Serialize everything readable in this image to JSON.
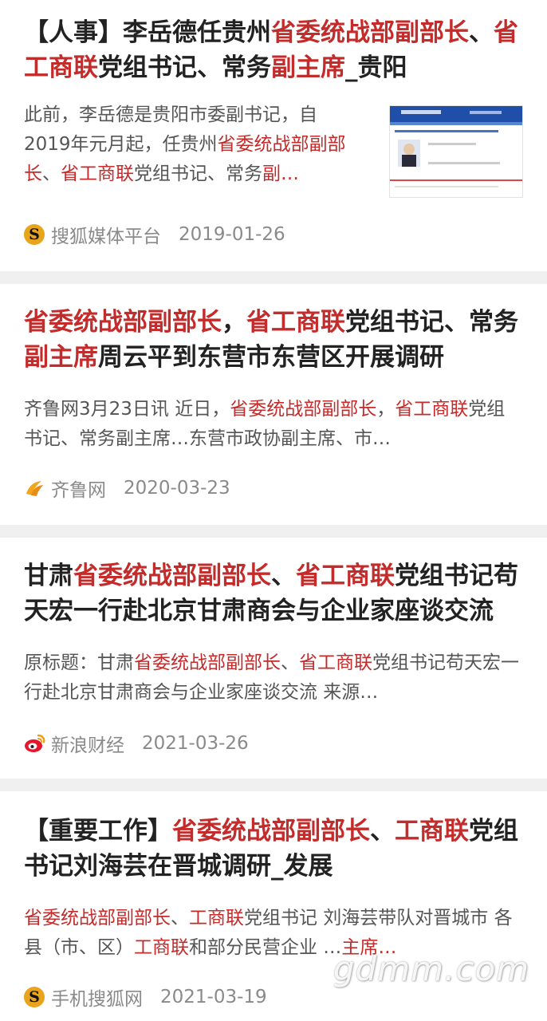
{
  "colors": {
    "highlight": "#c42b2b",
    "text": "#222222",
    "summary": "#555555",
    "meta": "#8a8a8a",
    "separator": "#f0f0f0"
  },
  "articles": [
    {
      "title": [
        {
          "t": "【人事】李岳德任贵州",
          "hl": false
        },
        {
          "t": "省委统战部副部长",
          "hl": true
        },
        {
          "t": "、",
          "hl": false
        },
        {
          "t": "省工商联",
          "hl": true
        },
        {
          "t": "党组书记、常务",
          "hl": false
        },
        {
          "t": "副主席",
          "hl": true
        },
        {
          "t": "_贵阳",
          "hl": false
        }
      ],
      "summary": [
        {
          "t": "此前，李岳德是贵阳市委副书记，自2019年元月起，任贵州",
          "hl": false
        },
        {
          "t": "省委统战部副部长",
          "hl": true
        },
        {
          "t": "、",
          "hl": false
        },
        {
          "t": "省工商联",
          "hl": true
        },
        {
          "t": "党组书记、常务",
          "hl": false
        },
        {
          "t": "副…",
          "hl": true
        }
      ],
      "source": "搜狐媒体平台",
      "source_icon": "sohu-icon",
      "date": "2019-01-26",
      "has_thumbnail": true
    },
    {
      "title": [
        {
          "t": "省委统战部副部长",
          "hl": true
        },
        {
          "t": "，",
          "hl": false
        },
        {
          "t": "省工商联",
          "hl": true
        },
        {
          "t": "党组书记、常务",
          "hl": false
        },
        {
          "t": "副主席",
          "hl": true
        },
        {
          "t": "周云平到东营市东营区开展调研",
          "hl": false
        }
      ],
      "summary": [
        {
          "t": "齐鲁网3月23日讯 近日，",
          "hl": false
        },
        {
          "t": "省委统战部副部长",
          "hl": true
        },
        {
          "t": "，",
          "hl": false
        },
        {
          "t": "省工商联",
          "hl": true
        },
        {
          "t": "党组书记、常务副主席…东营市政协副主席、市…",
          "hl": false
        }
      ],
      "source": "齐鲁网",
      "source_icon": "qilu-icon",
      "date": "2020-03-23",
      "has_thumbnail": false
    },
    {
      "title": [
        {
          "t": "甘肃",
          "hl": false
        },
        {
          "t": "省委统战部副部长",
          "hl": true
        },
        {
          "t": "、",
          "hl": false
        },
        {
          "t": "省工商联",
          "hl": true
        },
        {
          "t": "党组书记苟天宏一行赴北京甘肃商会与企业家座谈交流",
          "hl": false
        }
      ],
      "summary": [
        {
          "t": "原标题：甘肃",
          "hl": false
        },
        {
          "t": "省委统战部副部长",
          "hl": true
        },
        {
          "t": "、",
          "hl": false
        },
        {
          "t": "省工商联",
          "hl": true
        },
        {
          "t": "党组书记苟天宏一行赴北京甘肃商会与企业家座谈交流 来源…",
          "hl": false
        }
      ],
      "source": "新浪财经",
      "source_icon": "sina-icon",
      "date": "2021-03-26",
      "has_thumbnail": false
    },
    {
      "title": [
        {
          "t": "【重要工作】",
          "hl": false
        },
        {
          "t": "省委统战部副部长",
          "hl": true
        },
        {
          "t": "、",
          "hl": false
        },
        {
          "t": "工商联",
          "hl": true
        },
        {
          "t": "党组书记刘海芸在晋城调研_发展",
          "hl": false
        }
      ],
      "summary": [
        {
          "t": "省委统战部副部长",
          "hl": true
        },
        {
          "t": "、",
          "hl": false
        },
        {
          "t": "工商联",
          "hl": true
        },
        {
          "t": "党组书记 刘海芸带队对晋城市 各县（市、区）",
          "hl": false
        },
        {
          "t": "工商联",
          "hl": true
        },
        {
          "t": "和部分民营企业 …",
          "hl": false
        },
        {
          "t": "主席…",
          "hl": true
        }
      ],
      "source": "手机搜狐网",
      "source_icon": "sohu-icon",
      "date": "2021-03-19",
      "has_thumbnail": false
    }
  ],
  "watermark": "gdmm.com"
}
